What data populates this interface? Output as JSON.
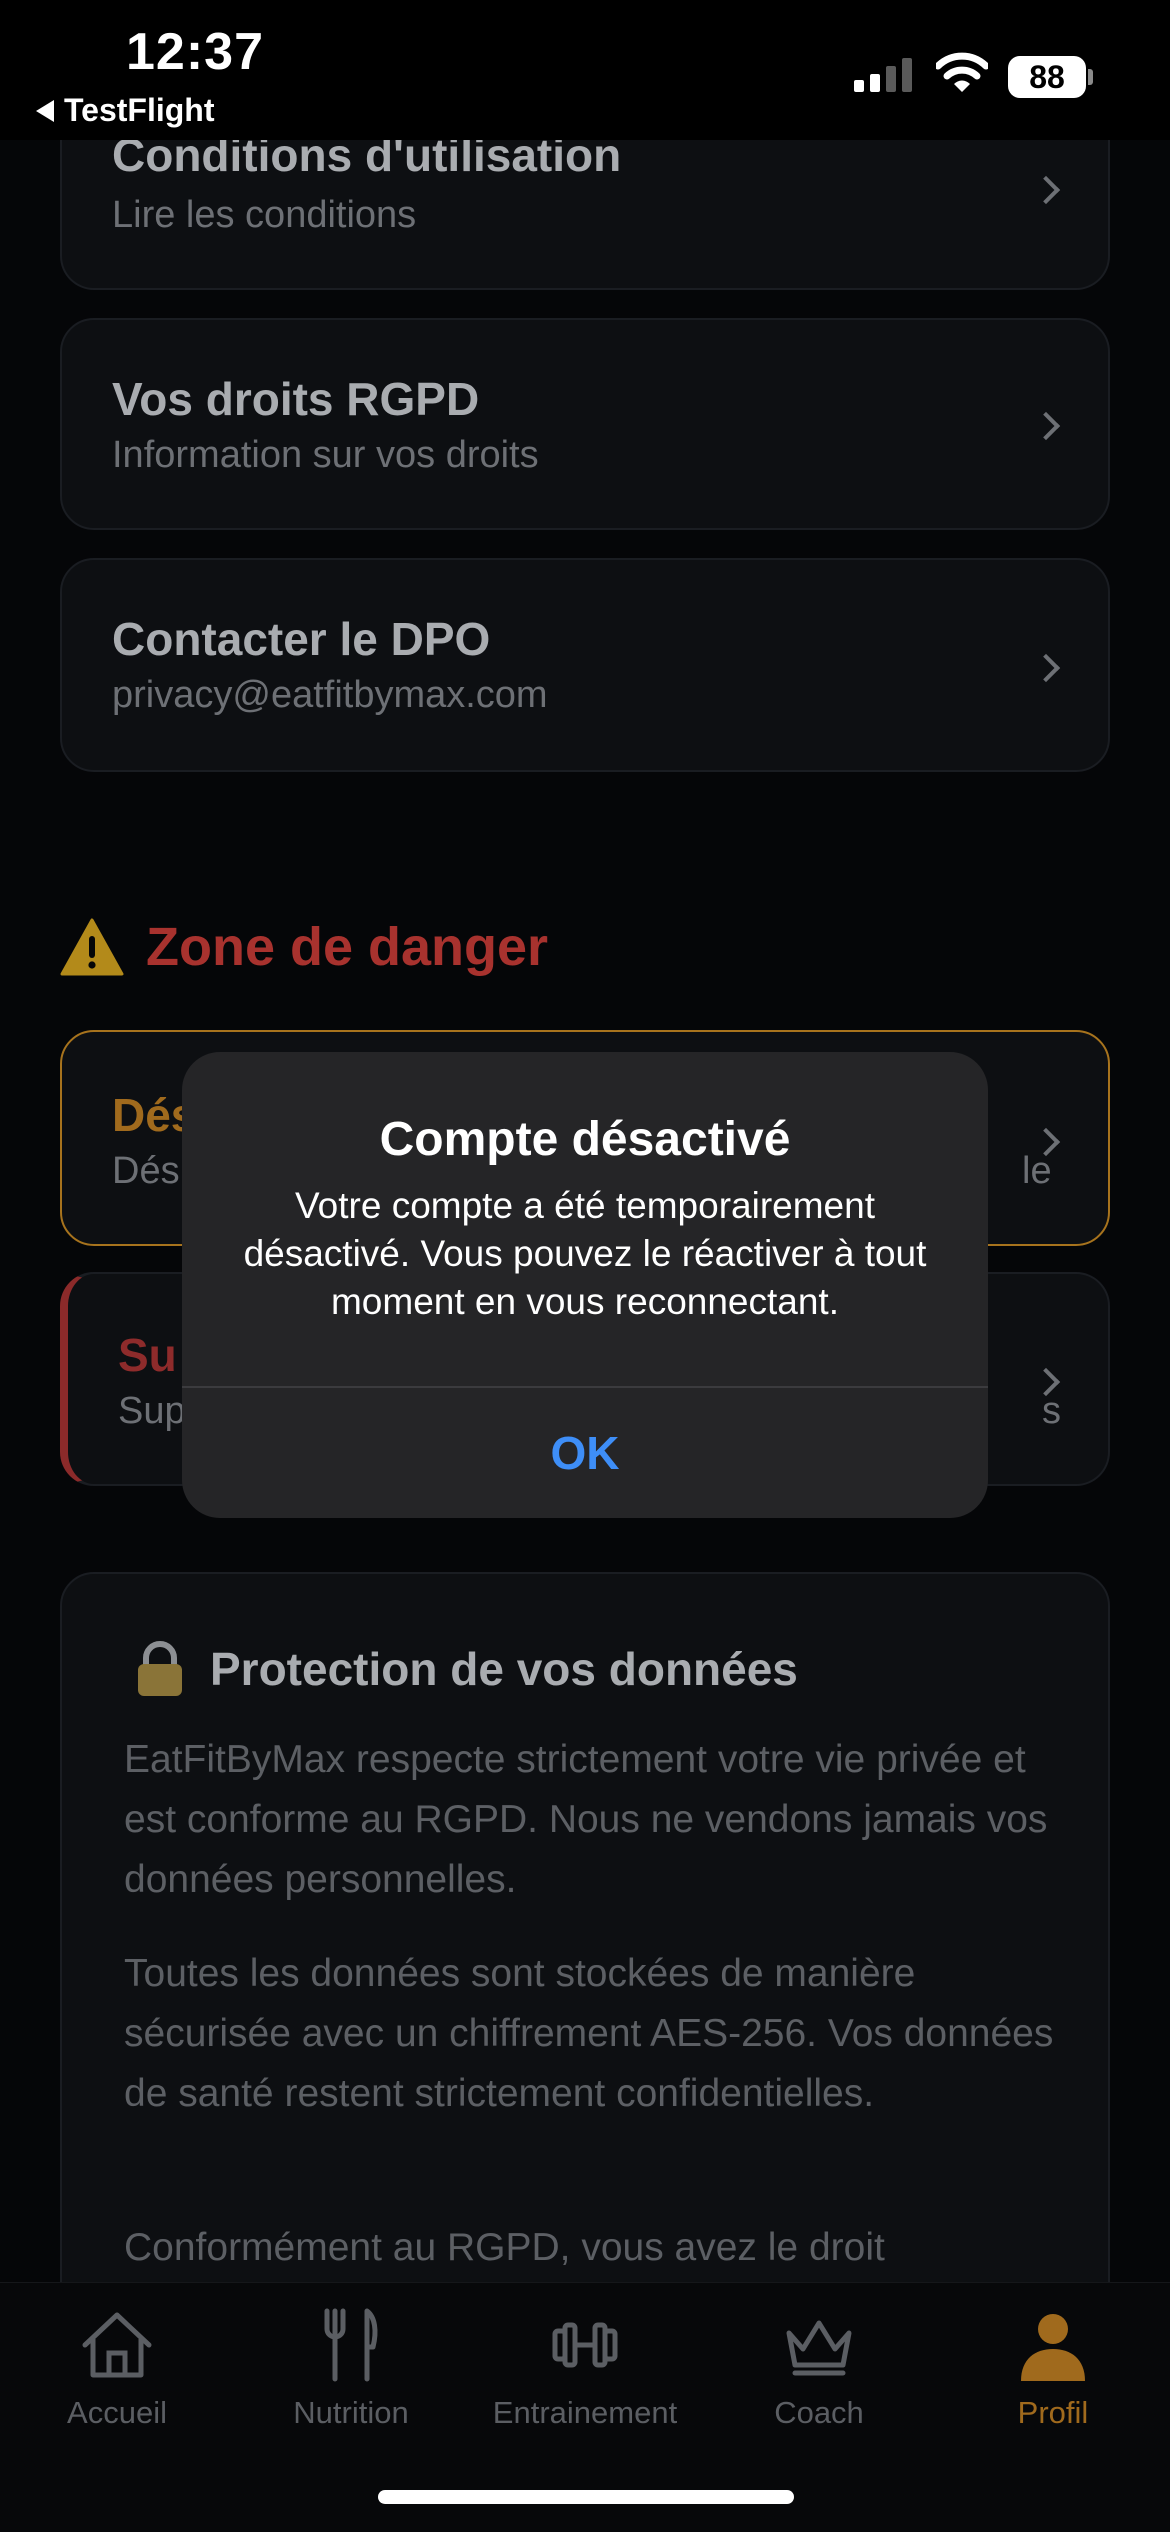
{
  "status_bar": {
    "time": "12:37",
    "back_app": "TestFlight",
    "battery": "88"
  },
  "links": [
    {
      "title": "Conditions d'utilisation",
      "subtitle": "Lire les conditions"
    },
    {
      "title": "Vos droits RGPD",
      "subtitle": "Information sur vos droits"
    },
    {
      "title": "Contacter le DPO",
      "subtitle": "privacy@eatfitbymax.com"
    }
  ],
  "danger": {
    "heading": "Zone de danger",
    "deactivate_title": "Dés",
    "deactivate_sub": "Dés",
    "deactivate_sub_tail": "le",
    "delete_title": "Su",
    "delete_sub": "Sup",
    "delete_sub_tail": "s"
  },
  "privacy": {
    "title": "Protection de vos données",
    "p1": "EatFitByMax respecte strictement votre vie privée et est conforme au RGPD. Nous ne vendons jamais vos données personnelles.",
    "p2": "Toutes les données sont stockées de manière sécurisée avec un chiffrement AES-256. Vos données de santé restent strictement confidentielles.",
    "p3": "Conformément au RGPD, vous avez le droit"
  },
  "alert": {
    "title": "Compte désactivé",
    "message": "Votre compte a été temporairement désactivé. Vous pouvez le réactiver à tout moment en vous reconnectant.",
    "ok": "OK"
  },
  "tabs": [
    {
      "label": "Accueil",
      "icon": "home-icon"
    },
    {
      "label": "Nutrition",
      "icon": "fork-knife-icon"
    },
    {
      "label": "Entrainement",
      "icon": "dumbbell-icon"
    },
    {
      "label": "Coach",
      "icon": "crown-icon"
    },
    {
      "label": "Profil",
      "icon": "person-icon",
      "active": true
    }
  ],
  "colors": {
    "accent_orange": "#a06a1d",
    "danger_red": "#a8322e",
    "alert_button_blue": "#3e8ef7"
  }
}
